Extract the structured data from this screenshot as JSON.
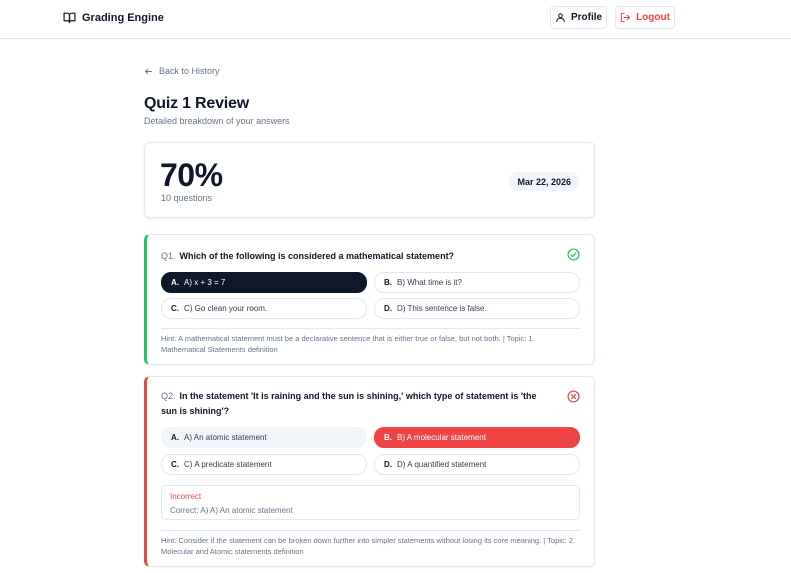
{
  "nav": {
    "brand": "Grading Engine",
    "profile_label": "Profile",
    "logout_label": "Logout"
  },
  "back_label": "Back to History",
  "title": "Quiz 1 Review",
  "subtitle": "Detailed breakdown of your answers",
  "score": {
    "value": "70%",
    "count": "10 questions",
    "date": "Mar 22, 2026"
  },
  "questions": [
    {
      "number": "Q1.",
      "text": "Which of the following is considered a mathematical statement?",
      "status": "correct",
      "options": [
        {
          "letter": "A.",
          "text": "A) x + 3 = 7",
          "state": "selected-correct"
        },
        {
          "letter": "B.",
          "text": "B) What time is it?",
          "state": "none"
        },
        {
          "letter": "C.",
          "text": "C) Go clean your room.",
          "state": "none"
        },
        {
          "letter": "D.",
          "text": "D) This sentence is false.",
          "state": "none"
        }
      ],
      "hint": "Hint: A mathematical statement must be a declarative sentence that is either true or false, but not both. | Topic: 1. Mathematical Statements definition"
    },
    {
      "number": "Q2.",
      "text": "In the statement 'It is raining and the sun is shining,' which type of statement is 'the sun is shining'?",
      "status": "incorrect",
      "options": [
        {
          "letter": "A.",
          "text": "A) An atomic statement",
          "state": "correct-answer"
        },
        {
          "letter": "B.",
          "text": "B) A molecular statement",
          "state": "selected-wrong"
        },
        {
          "letter": "C.",
          "text": "C) A predicate statement",
          "state": "none"
        },
        {
          "letter": "D.",
          "text": "D) A quantified statement",
          "state": "none"
        }
      ],
      "feedback_title": "Incorrect",
      "feedback_correct": "Correct: A) A) An atomic statement",
      "hint": "Hint: Consider if the statement can be broken down further into simpler statements without losing its core meaning. | Topic: 2. Molecular and Atomic statements definition"
    }
  ],
  "colors": {
    "correct": "#22c55e",
    "incorrect": "#ef4444",
    "selected": "#0f172a"
  }
}
